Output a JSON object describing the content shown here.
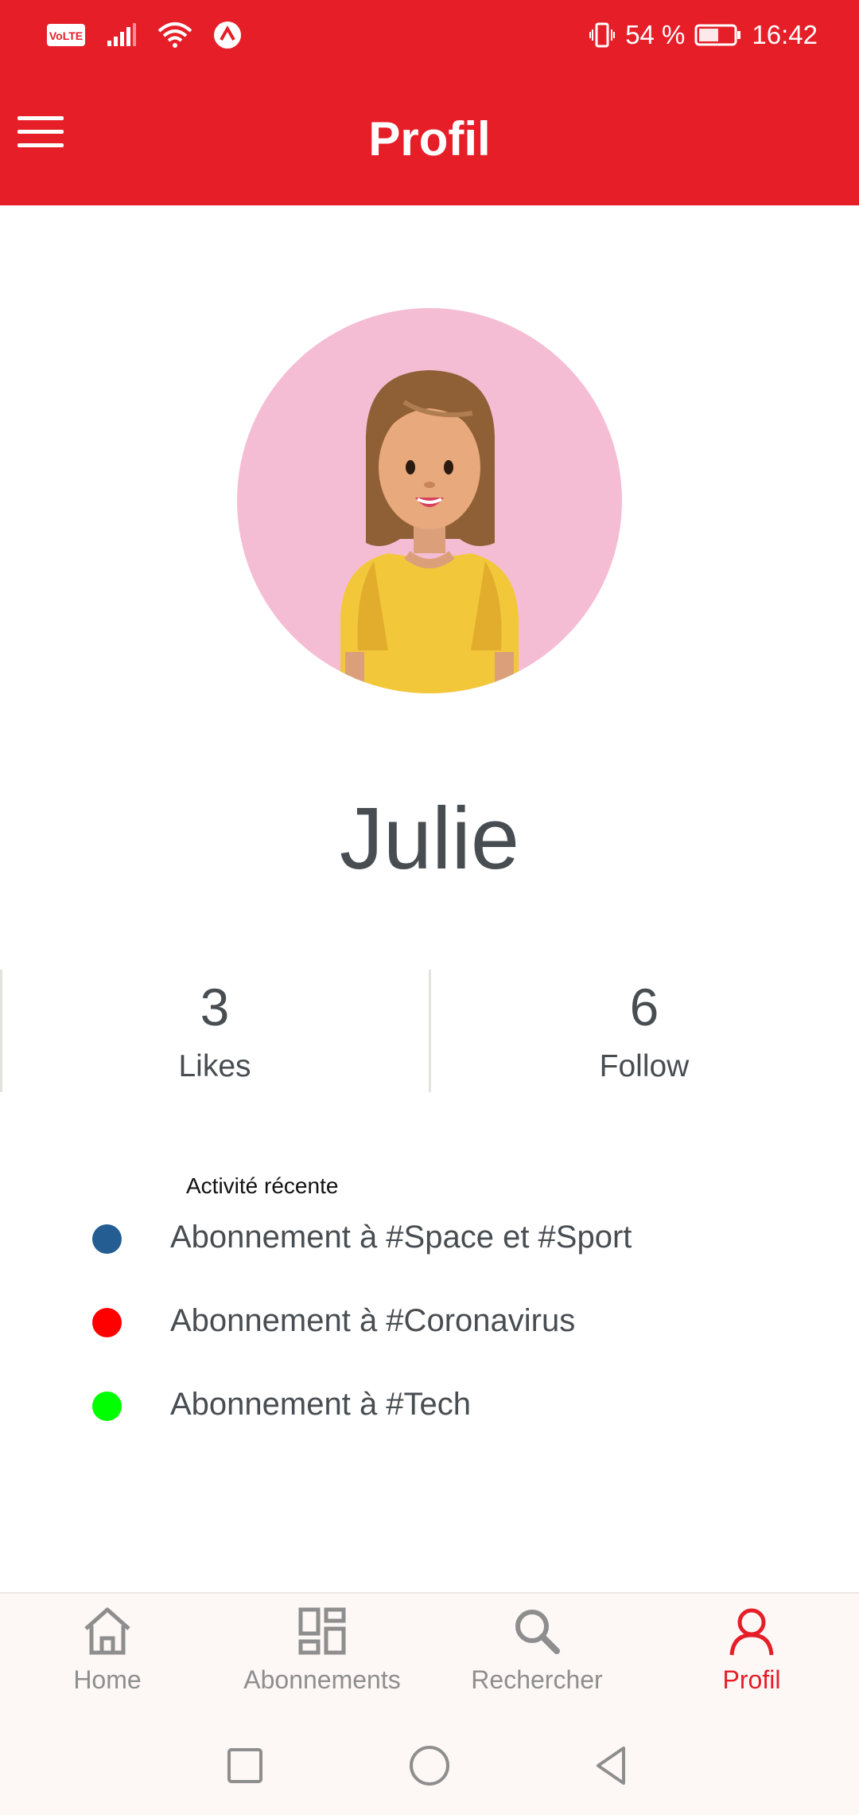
{
  "status_bar": {
    "volte": "VoLTE",
    "battery_percent": "54 %",
    "time": "16:42",
    "icons": [
      "volte-icon",
      "signal-icon",
      "wifi-icon",
      "app-notification-icon",
      "vibrate-icon",
      "battery-icon"
    ]
  },
  "header": {
    "title": "Profil",
    "menu_icon": "hamburger-menu-icon",
    "background_color": "#e61e28"
  },
  "profile": {
    "name": "Julie",
    "avatar_background": "#f5bdd4",
    "stats": [
      {
        "value": "3",
        "label": "Likes"
      },
      {
        "value": "6",
        "label": "Follow"
      }
    ]
  },
  "activity": {
    "title": "Activité récente",
    "items": [
      {
        "text": "Abonnement à #Space et #Sport",
        "color": "#235d91"
      },
      {
        "text": "Abonnement à #Coronavirus",
        "color": "#ff0000"
      },
      {
        "text": "Abonnement à #Tech",
        "color": "#00ff00"
      }
    ]
  },
  "bottom_nav": {
    "items": [
      {
        "label": "Home",
        "icon": "home-icon",
        "active": false
      },
      {
        "label": "Abonnements",
        "icon": "grid-icon",
        "active": false
      },
      {
        "label": "Rechercher",
        "icon": "search-icon",
        "active": false
      },
      {
        "label": "Profil",
        "icon": "user-icon",
        "active": true
      }
    ],
    "active_color": "#e61e28",
    "inactive_color": "#8e8e8e"
  },
  "system_nav": {
    "buttons": [
      "recent-apps-icon",
      "home-circle-icon",
      "back-triangle-icon"
    ]
  }
}
